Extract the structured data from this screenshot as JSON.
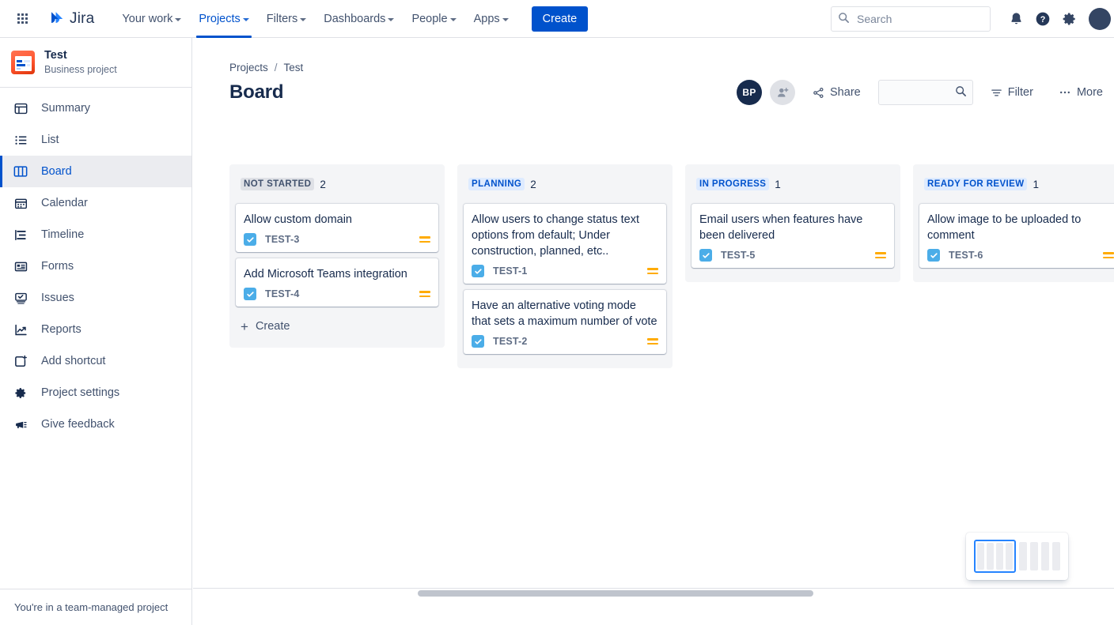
{
  "topnav": {
    "app_switcher": "app-switcher",
    "brand": "Jira",
    "items": [
      {
        "label": "Your work",
        "has_chevron": true,
        "active": false
      },
      {
        "label": "Projects",
        "has_chevron": true,
        "active": true
      },
      {
        "label": "Filters",
        "has_chevron": true,
        "active": false
      },
      {
        "label": "Dashboards",
        "has_chevron": true,
        "active": false
      },
      {
        "label": "People",
        "has_chevron": true,
        "active": false
      },
      {
        "label": "Apps",
        "has_chevron": true,
        "active": false
      }
    ],
    "create_label": "Create",
    "search_placeholder": "Search",
    "search_value": "",
    "icons": [
      "notifications-icon",
      "help-icon",
      "settings-icon",
      "profile-avatar"
    ],
    "accent_color": "#0052cc"
  },
  "sidebar": {
    "project_name": "Test",
    "project_type": "Business project",
    "items": [
      {
        "label": "Summary",
        "icon": "summary-icon",
        "selected": false
      },
      {
        "label": "List",
        "icon": "list-icon",
        "selected": false
      },
      {
        "label": "Board",
        "icon": "board-icon",
        "selected": true
      },
      {
        "label": "Calendar",
        "icon": "calendar-icon",
        "selected": false
      },
      {
        "label": "Timeline",
        "icon": "timeline-icon",
        "selected": false
      },
      {
        "label": "Forms",
        "icon": "forms-icon",
        "selected": false
      },
      {
        "label": "Issues",
        "icon": "issues-icon",
        "selected": false
      },
      {
        "label": "Reports",
        "icon": "reports-icon",
        "selected": false
      },
      {
        "label": "Add shortcut",
        "icon": "add-shortcut-icon",
        "selected": false
      },
      {
        "label": "Project settings",
        "icon": "settings-gear-icon",
        "selected": false
      },
      {
        "label": "Give feedback",
        "icon": "megaphone-icon",
        "selected": false
      }
    ],
    "footer_note": "You're in a team-managed project"
  },
  "breadcrumb": {
    "parent": "Projects",
    "separator": "/",
    "current": "Test"
  },
  "header": {
    "title": "Board",
    "avatar_initials": "BP",
    "add_people_icon": "add-people-icon",
    "share_label": "Share",
    "search_placeholder": "",
    "search_value": "",
    "filter_label": "Filter",
    "more_label": "More"
  },
  "board": {
    "columns": [
      {
        "status": "NOT STARTED",
        "badge_style": "grey",
        "count": "2",
        "show_create": true,
        "create_label": "Create",
        "cards": [
          {
            "title": "Allow custom domain",
            "key": "TEST-3",
            "type_icon": "task-icon",
            "priority": "medium"
          },
          {
            "title": "Add Microsoft Teams integration",
            "key": "TEST-4",
            "type_icon": "task-icon",
            "priority": "medium"
          }
        ]
      },
      {
        "status": "PLANNING",
        "badge_style": "blue",
        "count": "2",
        "show_create": false,
        "create_label": "Create",
        "cards": [
          {
            "title": "Allow users to change status text options from default; Under construction, planned, etc..",
            "key": "TEST-1",
            "type_icon": "task-icon",
            "priority": "medium"
          },
          {
            "title": "Have an alternative voting mode that sets a maximum number of vote",
            "key": "TEST-2",
            "type_icon": "task-icon",
            "priority": "medium"
          }
        ]
      },
      {
        "status": "IN PROGRESS",
        "badge_style": "blue",
        "count": "1",
        "show_create": false,
        "create_label": "Create",
        "cards": [
          {
            "title": "Email users when features have been delivered",
            "key": "TEST-5",
            "type_icon": "task-icon",
            "priority": "medium"
          }
        ]
      },
      {
        "status": "READY FOR REVIEW",
        "badge_style": "blue",
        "count": "1",
        "show_create": false,
        "create_label": "Create",
        "cards": [
          {
            "title": "Allow image to be uploaded to comment",
            "key": "TEST-6",
            "type_icon": "task-icon",
            "priority": "medium"
          }
        ]
      }
    ]
  },
  "minimap": {
    "name": "board-navigator",
    "visible_columns": 4,
    "total_columns": 8,
    "highlight_color": "#2684ff"
  },
  "colors": {
    "accent": "#0052cc",
    "column_bg": "#f4f5f7",
    "card_bg": "#ffffff",
    "priority_medium": "#ffab00",
    "task_type": "#4bade8",
    "text_primary": "#172b4d",
    "text_subtle": "#5e6c84"
  }
}
